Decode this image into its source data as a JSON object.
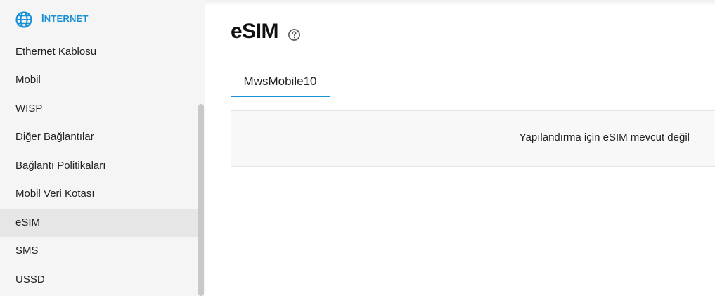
{
  "sidebar": {
    "section_title": "İNTERNET",
    "section_icon": "globe-icon",
    "accent_color": "#1a91d6",
    "items": [
      {
        "label": "Ethernet Kablosu"
      },
      {
        "label": "Mobil"
      },
      {
        "label": "WISP"
      },
      {
        "label": "Diğer Bağlantılar"
      },
      {
        "label": "Bağlantı Politikaları"
      },
      {
        "label": "Mobil Veri Kotası"
      },
      {
        "label": "eSIM",
        "active": true
      },
      {
        "label": "SMS"
      },
      {
        "label": "USSD"
      }
    ]
  },
  "main": {
    "title": "eSIM",
    "help_icon": "help-circle-icon",
    "tabs": [
      {
        "label": "MwsMobile10",
        "active": true
      }
    ],
    "panel": {
      "message": "Yapılandırma için eSIM mevcut değil"
    }
  }
}
